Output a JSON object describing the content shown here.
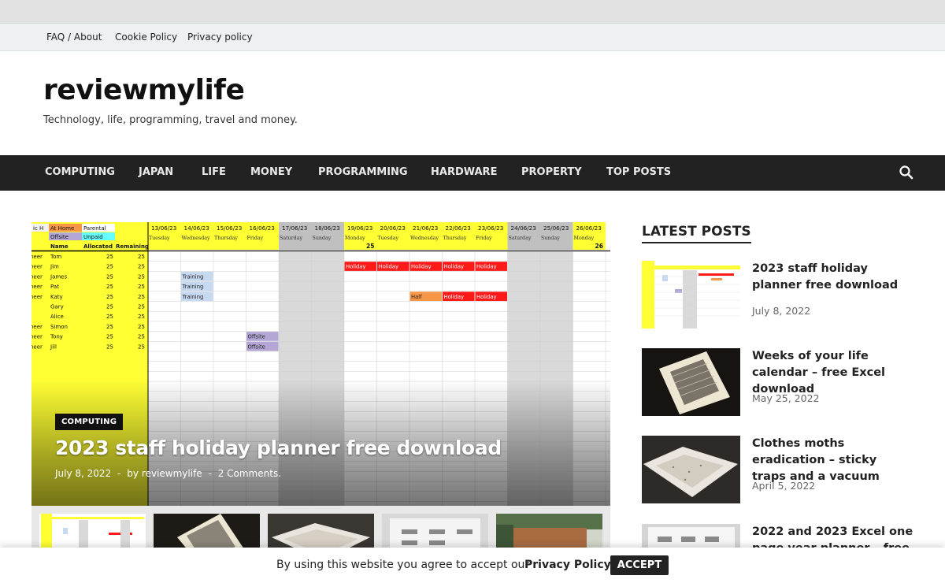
{
  "top_links": [
    "FAQ / About",
    "Cookie Policy",
    "Privacy policy"
  ],
  "site": {
    "title": "reviewmylife",
    "tagline": "Technology, life, programming, travel and money."
  },
  "nav": {
    "items": [
      "COMPUTING",
      "JAPAN",
      "LIFE",
      "MONEY",
      "PROGRAMMING",
      "HARDWARE",
      "PROPERTY",
      "TOP POSTS"
    ],
    "search_icon": "search-icon"
  },
  "featured": {
    "category": "COMPUTING",
    "title": "2023 staff holiday planner free download",
    "date": "July 8, 2022",
    "author_prefix": "by",
    "author": "reviewmylife",
    "comments": "2 Comments.",
    "separator": "-",
    "sheet": {
      "legend": [
        "ic H",
        "At Home",
        "Parental",
        "Offsite",
        "Unpaid"
      ],
      "col_headers": [
        "Name",
        "Allocated",
        "Remaining"
      ],
      "dates": [
        "13/06/23",
        "14/06/23",
        "15/06/23",
        "16/06/23",
        "17/06/23",
        "18/06/23",
        "19/06/23",
        "20/06/23",
        "21/06/23",
        "22/06/23",
        "23/06/23",
        "24/06/23",
        "25/06/23",
        "26/06/23"
      ],
      "days": [
        "Tuesday",
        "Wednesday",
        "Thursday",
        "Friday",
        "Saturday",
        "Sunday",
        "Monday",
        "Tuesday",
        "Wednesday",
        "Thursday",
        "Friday",
        "Saturday",
        "Sunday",
        "Monday"
      ],
      "week_numbers": [
        "25",
        "26"
      ],
      "rows": [
        {
          "role": "neer",
          "name": "Tom",
          "allocated": "25",
          "remaining": "25"
        },
        {
          "role": "neer",
          "name": "Jim",
          "allocated": "25",
          "remaining": "25"
        },
        {
          "role": "neer",
          "name": "James",
          "allocated": "25",
          "remaining": "25"
        },
        {
          "role": "neer",
          "name": "Pat",
          "allocated": "25",
          "remaining": "25"
        },
        {
          "role": "neer",
          "name": "Katy",
          "allocated": "25",
          "remaining": "25"
        },
        {
          "role": "",
          "name": "Gary",
          "allocated": "25",
          "remaining": "25"
        },
        {
          "role": "",
          "name": "Alice",
          "allocated": "25",
          "remaining": "25"
        },
        {
          "role": "neer",
          "name": "Simon",
          "allocated": "25",
          "remaining": "25"
        },
        {
          "role": "neer",
          "name": "Tony",
          "allocated": "25",
          "remaining": "25"
        },
        {
          "role": "neer",
          "name": "Jill",
          "allocated": "25",
          "remaining": "25"
        }
      ],
      "cell_labels": {
        "holiday": "Holiday",
        "training": "Training",
        "half": "Half",
        "offsite": "Offsite"
      }
    }
  },
  "latest": {
    "heading": "LATEST POSTS",
    "posts": [
      {
        "title": "2023 staff holiday planner free download",
        "date": "July 8, 2022"
      },
      {
        "title": "Weeks of your life calendar – free Excel download",
        "date": "May 25, 2022"
      },
      {
        "title": "Clothes moths eradication – sticky traps and a vacuum",
        "date": "April 5, 2022"
      },
      {
        "title": "2022 and 2023 Excel one page year planner – free",
        "date": ""
      }
    ]
  },
  "cookie": {
    "text": "By using this website you agree to accept our",
    "link": "Privacy Policy",
    "accept": "ACCEPT"
  },
  "colors": {
    "nav_bg": "#222222",
    "yellow": "#ffff33",
    "holiday_red": "#ff1a1a",
    "training_blue": "#c6d9f1",
    "half_orange": "#f79646",
    "offsite_purple": "#b4a7d6",
    "weekend_grey": "#d9d9d9"
  }
}
